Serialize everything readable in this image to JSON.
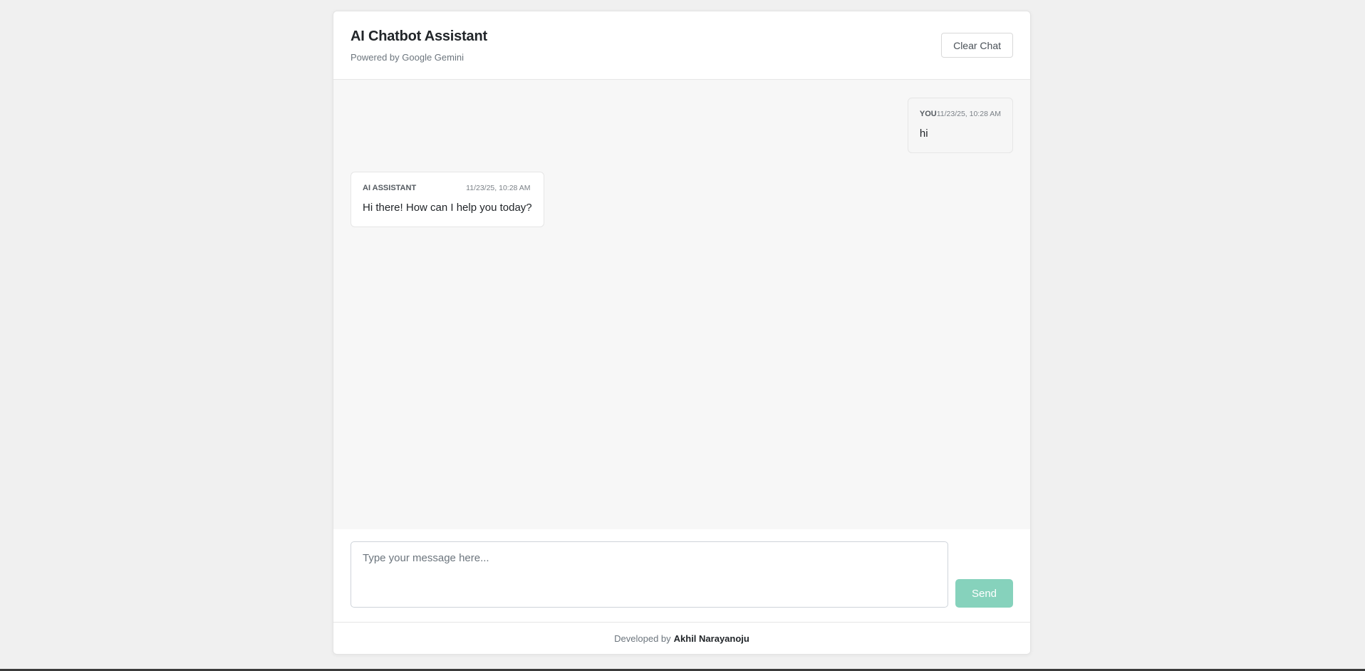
{
  "header": {
    "title": "AI Chatbot Assistant",
    "subtitle": "Powered by Google Gemini",
    "clear_label": "Clear Chat"
  },
  "messages": [
    {
      "sender": "YOU",
      "time": "11/23/25, 10:28 AM",
      "text": "hi"
    },
    {
      "sender": "AI ASSISTANT",
      "time": "11/23/25, 10:28 AM",
      "text": "Hi there! How can I help you today?"
    }
  ],
  "composer": {
    "placeholder": "Type your message here...",
    "value": "",
    "send_label": "Send",
    "send_color": "#86d2bc"
  },
  "footer": {
    "prefix": "Developed by",
    "name": "Akhil Narayanoju"
  }
}
